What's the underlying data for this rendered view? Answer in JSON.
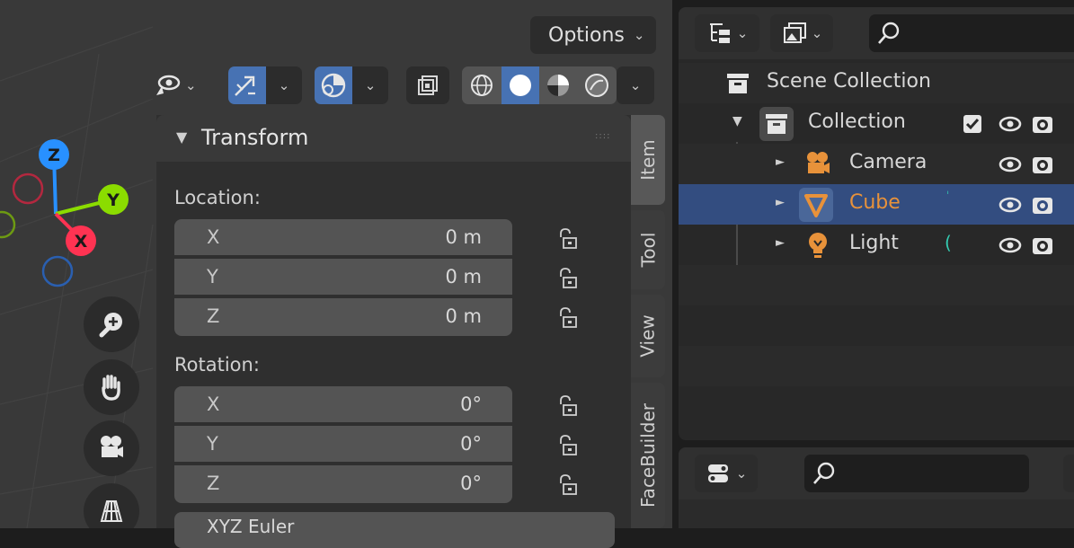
{
  "viewport": {
    "options_label": "Options",
    "gizmo": {
      "z": "Z",
      "y": "Y",
      "x": "X"
    }
  },
  "npanel": {
    "panel_title": "Transform",
    "location_label": "Location:",
    "rotation_label": "Rotation:",
    "location": [
      {
        "axis": "X",
        "value": "0 m"
      },
      {
        "axis": "Y",
        "value": "0 m"
      },
      {
        "axis": "Z",
        "value": "0 m"
      }
    ],
    "rotation": [
      {
        "axis": "X",
        "value": "0°"
      },
      {
        "axis": "Y",
        "value": "0°"
      },
      {
        "axis": "Z",
        "value": "0°"
      }
    ],
    "rotation_mode": "XYZ Euler",
    "tabs": [
      "Item",
      "Tool",
      "View",
      "FaceBuilder"
    ]
  },
  "outliner": {
    "scene_collection": "Scene Collection",
    "collection": "Collection",
    "items": [
      {
        "name": "Camera",
        "icon": "camera-icon"
      },
      {
        "name": "Cube",
        "icon": "mesh-icon",
        "selected": true
      },
      {
        "name": "Light",
        "icon": "light-icon"
      }
    ]
  },
  "colors": {
    "accent": "#4772b3",
    "selection_row": "#334d80",
    "axis_x": "#ff3352",
    "axis_y": "#8bdc00",
    "axis_z": "#2890ff",
    "object_orange": "#e8923a"
  }
}
